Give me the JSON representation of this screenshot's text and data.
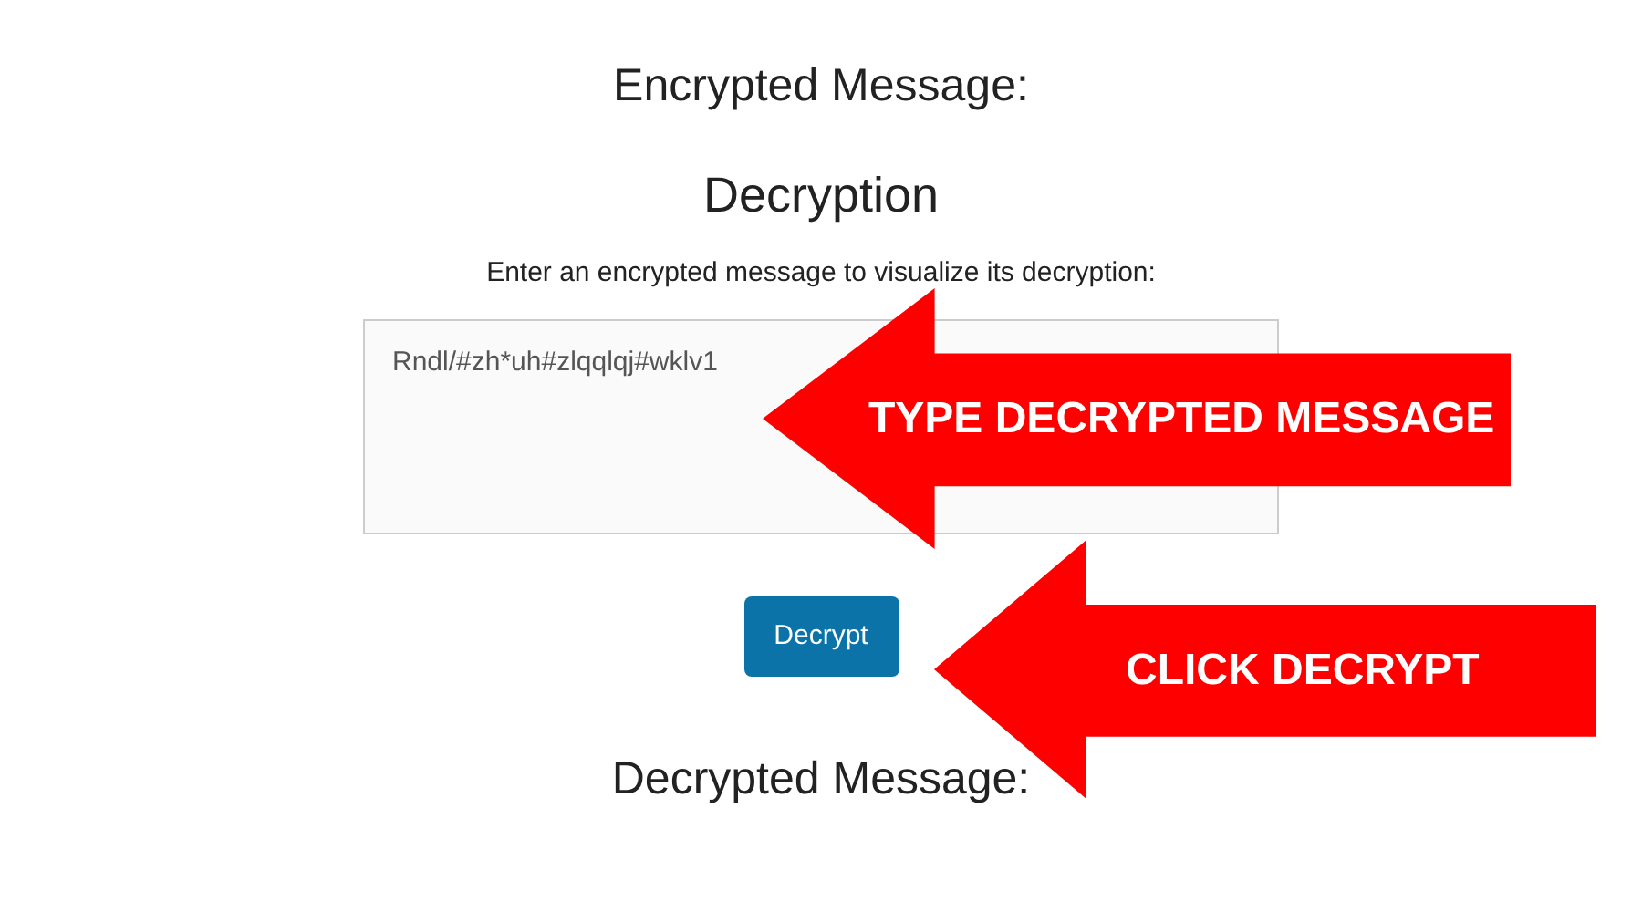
{
  "encrypted_heading": "Encrypted Message:",
  "decryption_title": "Decryption",
  "instruction": "Enter an encrypted message to visualize its decryption:",
  "message_field": {
    "value": "Rndl/#zh*uh#zlqqlqj#wklv1"
  },
  "decrypt_button": "Decrypt",
  "decrypted_heading": "Decrypted Message:",
  "annotations": [
    {
      "label": "TYPE DECRYPTED MESSAGE"
    },
    {
      "label": "CLICK DECRYPT"
    }
  ]
}
